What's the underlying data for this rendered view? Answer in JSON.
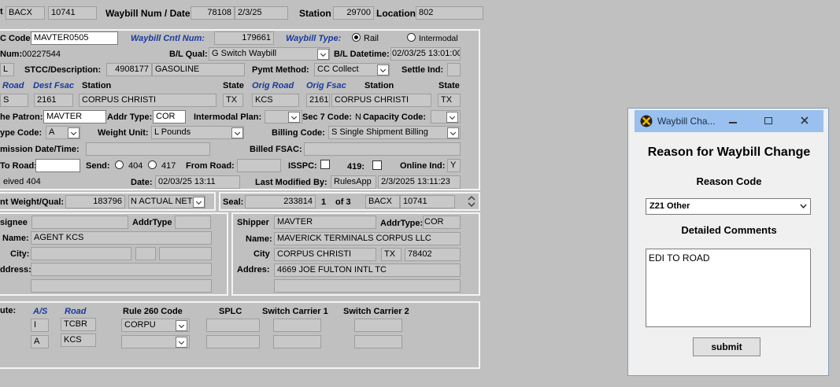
{
  "header": {
    "t_label": "t",
    "road": "BACX",
    "number": "10741",
    "waybill_num_date_label": "Waybill Num / Date",
    "waybill_num": "78108",
    "waybill_date": "2/3/25",
    "station_label": "Station",
    "station_code": "29700",
    "location_label": "Location",
    "location": "802"
  },
  "row1": {
    "code_label": "C Code:",
    "code": "MAVTER0505",
    "cntl_label": "Waybill Cntl Num:",
    "cntl": "179661",
    "type_label": "Waybill Type:",
    "rail": "Rail",
    "intermodal": "Intermodal"
  },
  "row2": {
    "num_label": "Num:",
    "num": "00227544",
    "bl_qual_label": "B/L Qual:",
    "bl_qual": "G Switch Waybill",
    "bl_datetime_label": "B/L Datetime:",
    "bl_datetime": "02/03/25 13:01:00"
  },
  "row3": {
    "l_val": "L",
    "stcc_label": "STCC/Description:",
    "stcc": "4908177",
    "desc": "GASOLINE",
    "pymt_label": "Pymt Method:",
    "pymt": "CC Collect",
    "settle_label": "Settle Ind:"
  },
  "row4": {
    "road_label": "Road",
    "dest_fsac_label": "Dest Fsac",
    "station_label": "Station",
    "state_label": "State",
    "orig_road_label": "Orig Road",
    "orig_fsac_label": "Orig Fsac",
    "orig_station_label": "Station",
    "orig_state_label": "State"
  },
  "row5": {
    "road": "S",
    "dest_fsac": "2161",
    "station": "CORPUS CHRISTI",
    "state": "TX",
    "orig_road": "KCS",
    "orig_fsac": "2161",
    "orig_station": "CORPUS CHRISTI",
    "orig_state": "TX"
  },
  "row6": {
    "patron_label": "he Patron:",
    "patron": "MAVTER",
    "addr_type_label": "Addr Type:",
    "addr_type": "COR",
    "intermodal_plan_label": "Intermodal Plan:",
    "sec7_label": "Sec 7 Code:",
    "sec7": "N",
    "capacity_label": "Capacity Code:"
  },
  "row7": {
    "type_code_label": "ype Code:",
    "type_code": "A",
    "weight_unit_label": "Weight Unit:",
    "weight_unit": "L Pounds",
    "billing_label": "Billing Code:",
    "billing": "S Single Shipment Billing"
  },
  "row8": {
    "mission_label": "mission Date/Time:",
    "billed_fsac_label": "Billed FSAC:"
  },
  "row9": {
    "to_road_label": "To Road:",
    "send_label": "Send:",
    "send_404": "404",
    "send_417": "417",
    "from_road_label": "From Road:",
    "isspc_label": "ISSPC:",
    "f419_label": "419:",
    "online_label": "Online Ind:",
    "online": "Y"
  },
  "row10": {
    "received": "eived 404",
    "date_label": "Date:",
    "date": "02/03/25 13:11",
    "last_mod_label": "Last Modified By:",
    "last_mod_user": "RulesApp",
    "last_mod_time": "2/3/2025 13:11:23"
  },
  "weight": {
    "label": "nt Weight/Qual:",
    "value": "183796",
    "qual": "N ACTUAL NET",
    "seal_label": "Seal:",
    "seal": "233814",
    "page": "1",
    "of": "of 3",
    "road": "BACX",
    "number": "10741"
  },
  "consignee": {
    "label": "signee",
    "addr_type_label": "AddrType",
    "name_label": "Name:",
    "name": "AGENT KCS",
    "city_label": "City:",
    "address_label": "ddress:"
  },
  "shipper": {
    "label": "Shipper",
    "code": "MAVTER",
    "addr_type_label": "AddrType:",
    "addr_type": "COR",
    "name_label": "Name:",
    "name": "MAVERICK TERMINALS CORPUS LLC",
    "city_label": "City",
    "city": "CORPUS CHRISTI",
    "state": "TX",
    "zip": "78402",
    "address_label": "Addres:",
    "address": "4669 JOE FULTON INTL TC"
  },
  "route": {
    "label": "ute:",
    "as_label": "A/S",
    "road_label": "Road",
    "rule260_label": "Rule 260 Code",
    "splc_label": "SPLC",
    "sw1_label": "Switch Carrier 1",
    "sw2_label": "Switch Carrier 2",
    "rows": [
      {
        "as": "I",
        "road": "TCBR",
        "rule260": "CORPU"
      },
      {
        "as": "A",
        "road": "KCS",
        "rule260": ""
      }
    ]
  },
  "dialog": {
    "title": "Waybill Cha...",
    "heading": "Reason for Waybill Change",
    "reason_code_label": "Reason Code",
    "reason_code": "Z21 Other",
    "comments_label": "Detailed Comments",
    "comments": "EDI TO ROAD",
    "submit": "submit",
    "title_color": "#99c0ef"
  }
}
